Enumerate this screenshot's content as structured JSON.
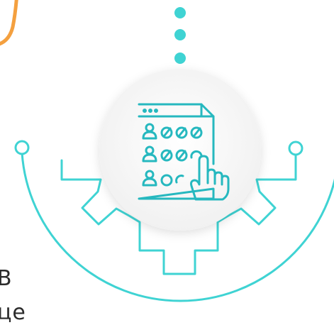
{
  "colors": {
    "accent": "#3fd3d3",
    "accent_dark": "#26b8bf",
    "orange": "#f4a03f",
    "circle_fill": "#f7f7f7",
    "text": "#2b2b2b"
  },
  "icons": {
    "center": "checklist-document-with-pointing-hand-icon",
    "gear": "gear-outline-icon",
    "dots": "vertical-dots-icon",
    "left_connector": "circuit-connector-node-icon",
    "right_connector": "circuit-connector-node-icon"
  },
  "edge_text": {
    "line1": "B",
    "line2": "це"
  }
}
